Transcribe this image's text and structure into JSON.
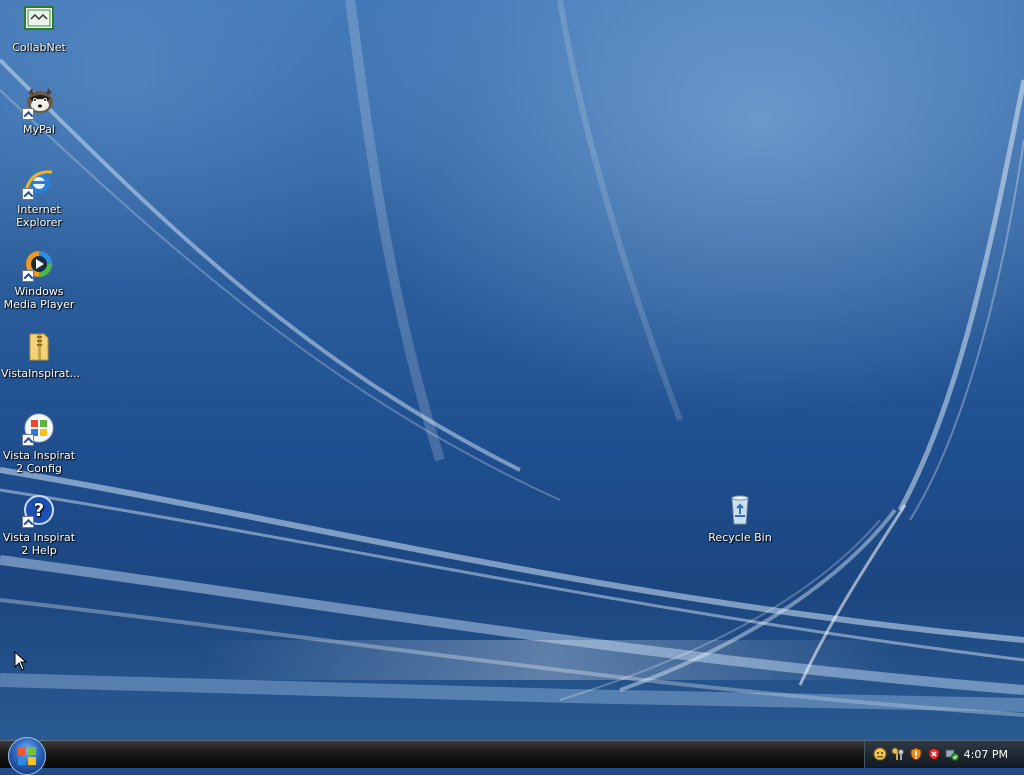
{
  "desktop": {
    "icons": [
      {
        "label": "CollabNet"
      },
      {
        "label": "MyPal"
      },
      {
        "label": "Internet Explorer"
      },
      {
        "label": "Windows Media Player"
      },
      {
        "label": "VistaInspirat..."
      },
      {
        "label": "Vista Inspirat 2 Config"
      },
      {
        "label": "Vista Inspirat 2 Help"
      },
      {
        "label": "Recycle Bin"
      }
    ]
  },
  "taskbar": {
    "clock": "4:07 PM",
    "tray_icons": [
      "messenger-icon",
      "keys-icon",
      "security-shield-icon",
      "firewall-icon",
      "network-status-icon"
    ]
  },
  "colors": {
    "desktop_blue": "#2d5f9e",
    "taskbar": "#1b1b1b",
    "start_orb": "#2a62b8"
  }
}
